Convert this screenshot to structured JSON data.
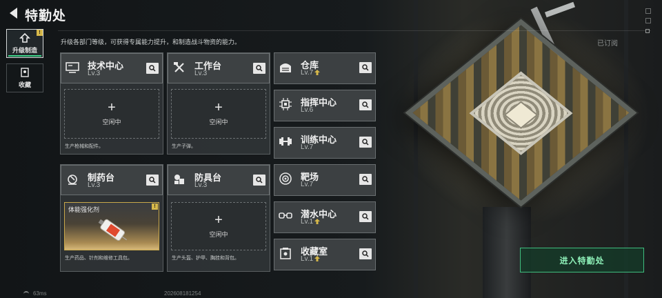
{
  "header": {
    "title": "特勤处",
    "hint": "升级各部门等级，可获得专属能力提升，和制造战斗物资的能力。",
    "subscribed": "已订阅"
  },
  "sidebar": {
    "tabs": [
      {
        "label": "升级制造",
        "badge": "!",
        "active": true
      },
      {
        "label": "收藏",
        "active": false
      }
    ]
  },
  "departments_left": [
    {
      "name": "技术中心",
      "level": "Lv.3",
      "slot": "空闲中",
      "desc": "生产枪械和配件。"
    },
    {
      "name": "工作台",
      "level": "Lv.3",
      "slot": "空闲中",
      "desc": "生产子弹。"
    },
    {
      "name": "制药台",
      "level": "Lv.3",
      "item": "体能强化剂",
      "item_badge": "!",
      "desc": "生产药品、针剂和维修工具包。"
    },
    {
      "name": "防具台",
      "level": "Lv.3",
      "slot": "空闲中",
      "desc": "生产头盔、护甲、胸挂和背包。"
    }
  ],
  "departments_right": [
    {
      "name": "仓库",
      "level": "Lv.7",
      "upgradable": true
    },
    {
      "name": "指挥中心",
      "level": "Lv.6",
      "upgradable": false
    },
    {
      "name": "训练中心",
      "level": "Lv.7",
      "upgradable": false
    },
    {
      "name": "靶场",
      "level": "Lv.7",
      "upgradable": false
    },
    {
      "name": "潜水中心",
      "level": "Lv.1",
      "upgradable": true
    },
    {
      "name": "收藏室",
      "level": "Lv.1",
      "upgradable": true
    }
  ],
  "enter_button": "进入特勤处",
  "status": {
    "latency": "63ms",
    "timestamp": "202608181254"
  },
  "colors": {
    "accent": "#3fd38a",
    "badge": "#d6b84a",
    "enter_text": "#8ef0b8"
  }
}
